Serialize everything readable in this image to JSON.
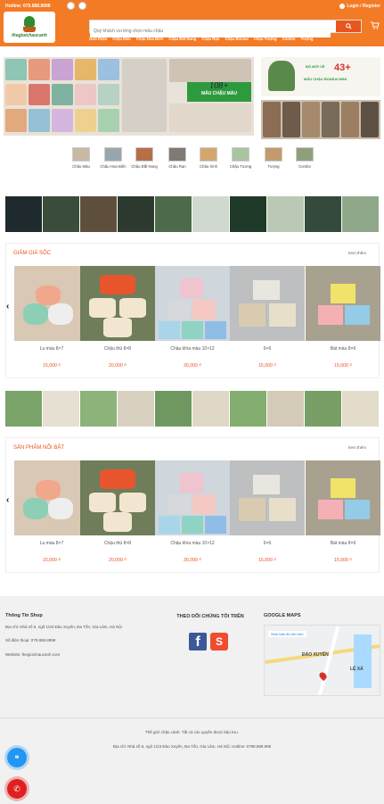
{
  "header": {
    "hotline": "Hotline: 079.888.8998",
    "login": "Login / Register",
    "logo_text": "thegioichaucanh",
    "search_placeholder": "Quý khách vui lòng chọn mẫu chậu",
    "nav": [
      "Giới thiệu",
      "Chậu Màu",
      "Chậu Hoa Biển",
      "Chậu Đất Nung",
      "Chậu Rạn",
      "Chậu Bonsai",
      "Chậu Tượng",
      "Combo",
      "Tượng"
    ],
    "colors": {
      "brand": "#f47b25",
      "accent": "#e8551d"
    }
  },
  "banner": {
    "text1": "108+",
    "text2": "MẪU CHẬU MÀU",
    "promo_top": "BỘ MỚI VỀ",
    "promo_count": "43+",
    "promo_bottom": "MẪU CHẬU BONSAI MINI"
  },
  "categories": [
    "Chậu Màu",
    "Chậu Hoa Biển",
    "Chậu Đất Nung",
    "Chậu Rạn",
    "Chậu Xinh",
    "Chậu Tượng",
    "Tượng",
    "Combo"
  ],
  "sale_section": {
    "title": "GIẢM GIÁ SỐC",
    "more": "Xem thêm",
    "products": [
      {
        "name": "Lu màu 8×7",
        "price": "15,000 ₫"
      },
      {
        "name": "Chậu thú 8×8",
        "price": "20,000 ₫"
      },
      {
        "name": "Chậu khía màu 10×12",
        "price": "30,000 ₫"
      },
      {
        "name": "6×6",
        "price": "15,000 ₫"
      },
      {
        "name": "Bát màu 8×6",
        "price": "15,000 ₫"
      }
    ]
  },
  "featured_section": {
    "title": "SẢN PHẨM NỔI BẬT",
    "more": "Xem thêm",
    "products": [
      {
        "name": "Lu màu 8×7",
        "price": "15,000 ₫"
      },
      {
        "name": "Chậu thú 8×8",
        "price": "20,000 ₫"
      },
      {
        "name": "Chậu khía màu 10×12",
        "price": "30,000 ₫"
      },
      {
        "name": "6×6",
        "price": "15,000 ₫"
      },
      {
        "name": "Bát màu 8×6",
        "price": "15,000 ₫"
      }
    ]
  },
  "footer": {
    "shop_title": "Thông Tin Shop",
    "address": "Địa chỉ: Nhà số 6, ngõ 1/23 Đào Xuyên, Đa Tốn, Gia Lâm, Hà Nội",
    "phone": "Số điện thoại: 079.888.8998",
    "website": "Website: thegioichaucanh.com",
    "follow_title": "THEO DÕI CHÚNG TÔI TRÊN",
    "map_title": "GOOGLE MAPS",
    "map_link": "Xem bản đồ lớn hơn",
    "map_label1": "ĐÀO XUYÊN",
    "map_label2": "LỆ XÁ",
    "copyright": "Thế giới chậu cảnh. Tất cả các quyền được bảo lưu.",
    "bottom_address": "Địa chỉ: Nhà số 6, ngõ 1/23 Đào Xuyên, Đa Tốn, Gia Lâm, Hà Nội. Hotline: 0798.888.998"
  }
}
